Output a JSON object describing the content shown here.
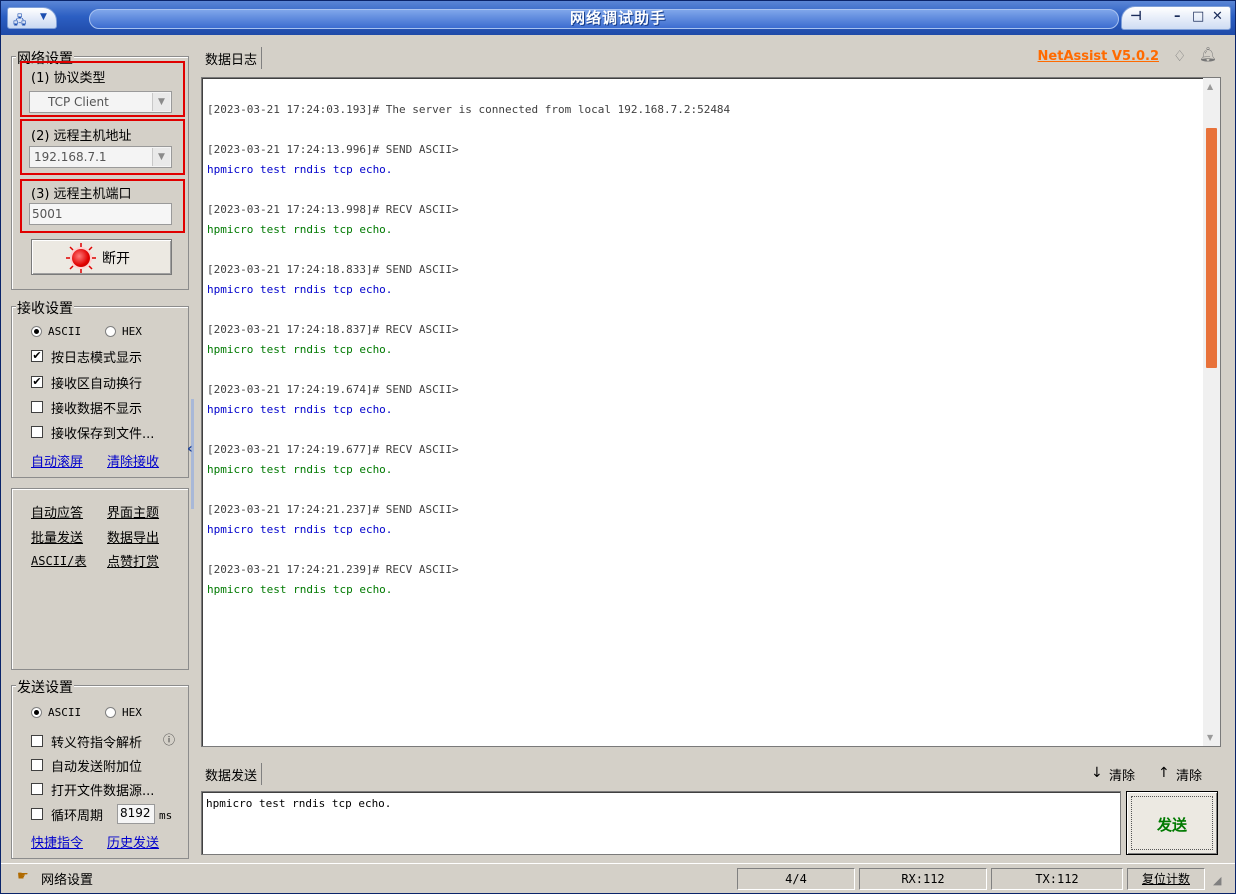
{
  "window": {
    "title": "网络调试助手"
  },
  "network": {
    "group_label": "网络设置",
    "protocol_label": "(1) 协议类型",
    "protocol_value": "TCP Client",
    "host_label": "(2) 远程主机地址",
    "host_value": "192.168.7.1",
    "port_label": "(3) 远程主机端口",
    "port_value": "5001",
    "connect_label": "断开"
  },
  "receive": {
    "group_label": "接收设置",
    "ascii_label": "ASCII",
    "hex_label": "HEX",
    "options": [
      {
        "label": "按日志模式显示",
        "checked": true
      },
      {
        "label": "接收区自动换行",
        "checked": true
      },
      {
        "label": "接收数据不显示",
        "checked": false
      },
      {
        "label": "接收保存到文件...",
        "checked": false
      }
    ],
    "auto_scroll": "自动滚屏",
    "clear_recv": "清除接收"
  },
  "tools": {
    "row1": [
      "自动应答",
      "界面主题"
    ],
    "row2": [
      "批量发送",
      "数据导出"
    ],
    "row3": [
      "ASCII/表",
      "点赞打赏"
    ]
  },
  "send_settings": {
    "group_label": "发送设置",
    "ascii_label": "ASCII",
    "hex_label": "HEX",
    "options": [
      {
        "label": "转义符指令解析",
        "checked": false
      },
      {
        "label": "自动发送附加位",
        "checked": false
      },
      {
        "label": "打开文件数据源...",
        "checked": false
      },
      {
        "label": "循环周期",
        "checked": false
      }
    ],
    "cycle_value": "8192",
    "cycle_unit": "ms",
    "shortcut": "快捷指令",
    "history": "历史发送"
  },
  "log": {
    "tab": "数据日志",
    "version": "NetAssist V5.0.2",
    "entries": [
      {
        "meta": "[2023-03-21 17:24:03.193]# The server is connected from local 192.168.7.2:52484",
        "kind": "info",
        "text": ""
      },
      {
        "meta": "[2023-03-21 17:24:13.996]# SEND ASCII>",
        "kind": "send",
        "text": "hpmicro test rndis tcp echo."
      },
      {
        "meta": "[2023-03-21 17:24:13.998]# RECV ASCII>",
        "kind": "recv",
        "text": "hpmicro test rndis tcp echo."
      },
      {
        "meta": "[2023-03-21 17:24:18.833]# SEND ASCII>",
        "kind": "send",
        "text": "hpmicro test rndis tcp echo."
      },
      {
        "meta": "[2023-03-21 17:24:18.837]# RECV ASCII>",
        "kind": "recv",
        "text": "hpmicro test rndis tcp echo."
      },
      {
        "meta": "[2023-03-21 17:24:19.674]# SEND ASCII>",
        "kind": "send",
        "text": "hpmicro test rndis tcp echo."
      },
      {
        "meta": "[2023-03-21 17:24:19.677]# RECV ASCII>",
        "kind": "recv",
        "text": "hpmicro test rndis tcp echo."
      },
      {
        "meta": "[2023-03-21 17:24:21.237]# SEND ASCII>",
        "kind": "send",
        "text": "hpmicro test rndis tcp echo."
      },
      {
        "meta": "[2023-03-21 17:24:21.239]# RECV ASCII>",
        "kind": "recv",
        "text": "hpmicro test rndis tcp echo."
      }
    ]
  },
  "send": {
    "tab": "数据发送",
    "clear1": "清除",
    "clear2": "清除",
    "input_value": "hpmicro test rndis tcp echo.",
    "button": "发送"
  },
  "status": {
    "left": "网络设置",
    "count": "4/4",
    "rx": "RX:112",
    "tx": "TX:112",
    "reset": "复位计数"
  },
  "colors": {
    "send": "#0000cc",
    "recv": "#007a00",
    "accent": "#ff6a00",
    "highlight": "#e00000"
  }
}
